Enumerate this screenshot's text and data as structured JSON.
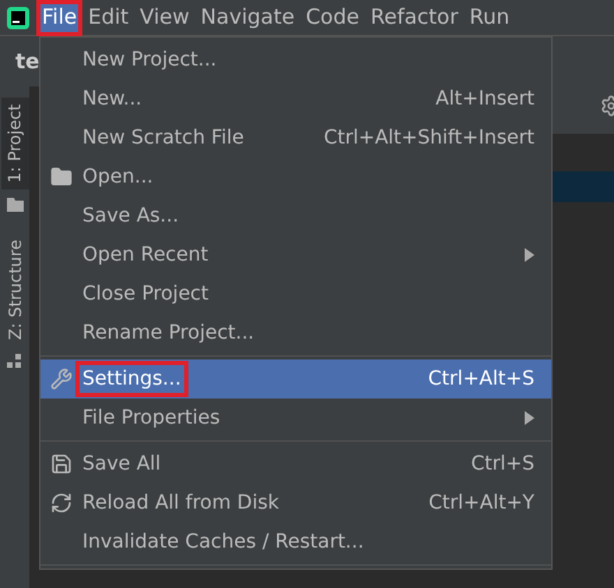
{
  "menubar": [
    {
      "label": "File",
      "selected": true,
      "highlighted": true
    },
    {
      "label": "Edit",
      "selected": false,
      "highlighted": false
    },
    {
      "label": "View",
      "selected": false,
      "highlighted": false
    },
    {
      "label": "Navigate",
      "selected": false,
      "highlighted": false
    },
    {
      "label": "Code",
      "selected": false,
      "highlighted": false
    },
    {
      "label": "Refactor",
      "selected": false,
      "highlighted": false
    },
    {
      "label": "Run",
      "selected": false,
      "highlighted": false
    }
  ],
  "editor_tab": {
    "label": "te"
  },
  "tool_strip": [
    {
      "label": "1: Project"
    },
    {
      "label": "Z: Structure"
    }
  ],
  "menu": [
    {
      "kind": "item",
      "label": "New Project...",
      "selected": false,
      "highlighted": false,
      "submenu": false
    },
    {
      "kind": "item",
      "label": "New...",
      "shortcut": "Alt+Insert",
      "selected": false,
      "highlighted": false,
      "submenu": false
    },
    {
      "kind": "item",
      "label": "New Scratch File",
      "shortcut": "Ctrl+Alt+Shift+Insert",
      "selected": false,
      "highlighted": false,
      "submenu": false
    },
    {
      "kind": "item",
      "label": "Open...",
      "selected": false,
      "highlighted": false,
      "submenu": false
    },
    {
      "kind": "item",
      "label": "Save As...",
      "selected": false,
      "highlighted": false,
      "submenu": false
    },
    {
      "kind": "item",
      "label": "Open Recent",
      "selected": false,
      "highlighted": false,
      "submenu": true
    },
    {
      "kind": "item",
      "label": "Close Project",
      "selected": false,
      "highlighted": false,
      "submenu": false
    },
    {
      "kind": "item",
      "label": "Rename Project...",
      "selected": false,
      "highlighted": false,
      "submenu": false
    },
    {
      "kind": "separator"
    },
    {
      "kind": "item",
      "label": "Settings...",
      "shortcut": "Ctrl+Alt+S",
      "selected": true,
      "highlighted": true,
      "submenu": false
    },
    {
      "kind": "item",
      "label": "File Properties",
      "selected": false,
      "highlighted": false,
      "submenu": true
    },
    {
      "kind": "separator"
    },
    {
      "kind": "item",
      "label": "Save All",
      "shortcut": "Ctrl+S",
      "selected": false,
      "highlighted": false,
      "submenu": false
    },
    {
      "kind": "item",
      "label": "Reload All from Disk",
      "shortcut": "Ctrl+Alt+Y",
      "selected": false,
      "highlighted": false,
      "submenu": false
    },
    {
      "kind": "item",
      "label": "Invalidate Caches / Restart...",
      "selected": false,
      "highlighted": false,
      "submenu": false
    },
    {
      "kind": "separator"
    }
  ]
}
